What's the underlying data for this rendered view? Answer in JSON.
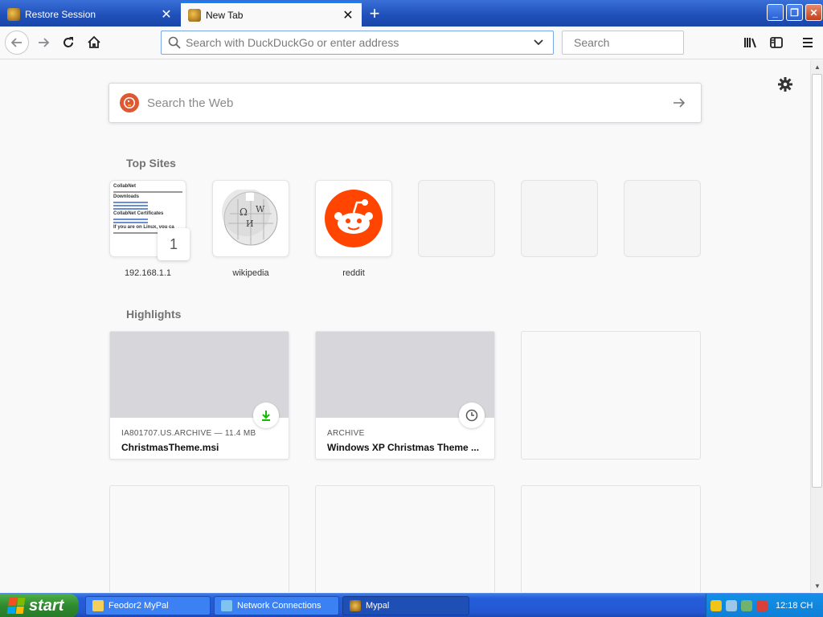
{
  "tabs": [
    {
      "title": "Restore Session",
      "active": false
    },
    {
      "title": "New Tab",
      "active": true
    }
  ],
  "toolbar": {
    "url_placeholder": "Search with DuckDuckGo or enter address",
    "search_placeholder": "Search"
  },
  "page": {
    "web_search_placeholder": "Search the Web",
    "top_sites_title": "Top Sites",
    "highlights_title": "Highlights",
    "top_sites": [
      {
        "label": "192.168.1.1",
        "badge": "1",
        "thumb_heading": "CollabNet",
        "thumb_sub1": "Downloads",
        "thumb_sub2": "CollabNet Certificates",
        "thumb_sub3": "If you are on Linux, you ca"
      },
      {
        "label": "wikipedia"
      },
      {
        "label": "reddit"
      },
      {
        "label": ""
      },
      {
        "label": ""
      },
      {
        "label": ""
      }
    ],
    "highlights": [
      {
        "source": "IA801707.US.ARCHIVE — 11.4 MB",
        "title": "ChristmasTheme.msi",
        "icon": "download-icon"
      },
      {
        "source": "ARCHIVE",
        "title": "Windows XP Christmas Theme ...",
        "icon": "clock-icon"
      }
    ]
  },
  "taskbar": {
    "start_label": "start",
    "tasks": [
      "Feodor2 MyPal",
      "Network Connections",
      "Mypal"
    ],
    "clock": "12:18 CH"
  },
  "colors": {
    "accent": "#0a84ff",
    "ddg": "#de5833",
    "reddit": "#ff4500",
    "download_green": "#12bc00"
  }
}
